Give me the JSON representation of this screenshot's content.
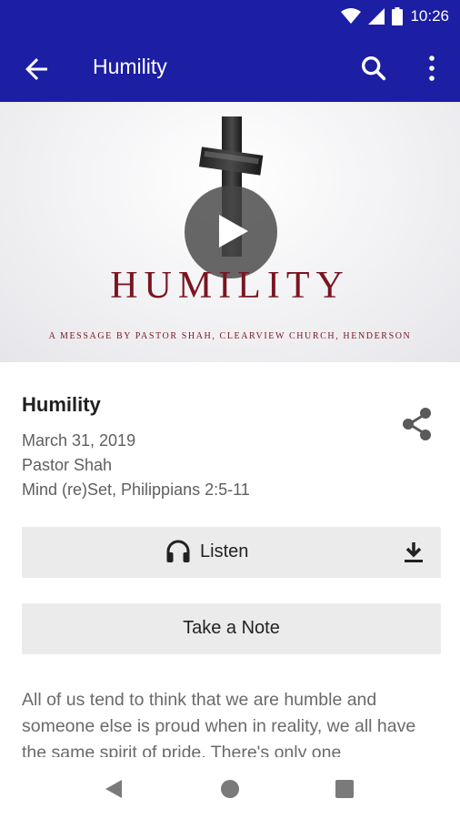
{
  "status_bar": {
    "time": "10:26",
    "icons": [
      "wifi-icon",
      "signal-icon",
      "battery-icon"
    ]
  },
  "app_bar": {
    "title": "Humility",
    "icons": [
      "back-arrow-icon",
      "search-icon",
      "more-vert-icon"
    ]
  },
  "hero": {
    "title": "HUMILITY",
    "subtitle": "A MESSAGE BY PASTOR SHAH, CLEARVIEW CHURCH, HENDERSON",
    "icons": [
      "cross-image",
      "play-icon"
    ]
  },
  "sermon": {
    "title": "Humility",
    "date": "March 31, 2019",
    "speaker": "Pastor Shah",
    "series": "Mind (re)Set, Philippians 2:5-11"
  },
  "actions": {
    "listen_label": "Listen",
    "take_note_label": "Take a Note",
    "icons": [
      "share-icon",
      "headphones-icon",
      "download-icon"
    ]
  },
  "description": "All of us tend to think that we are humble and someone else is proud when in reality, we all have the same spirit of pride. There's only one",
  "colors": {
    "primary": "#1c1ea4",
    "hero_text": "#7a1520",
    "button_bg": "#ebebeb",
    "secondary_text": "#5f5f5f"
  },
  "nav_bar": {
    "icons": [
      "nav-back-icon",
      "nav-home-icon",
      "nav-recents-icon"
    ]
  }
}
